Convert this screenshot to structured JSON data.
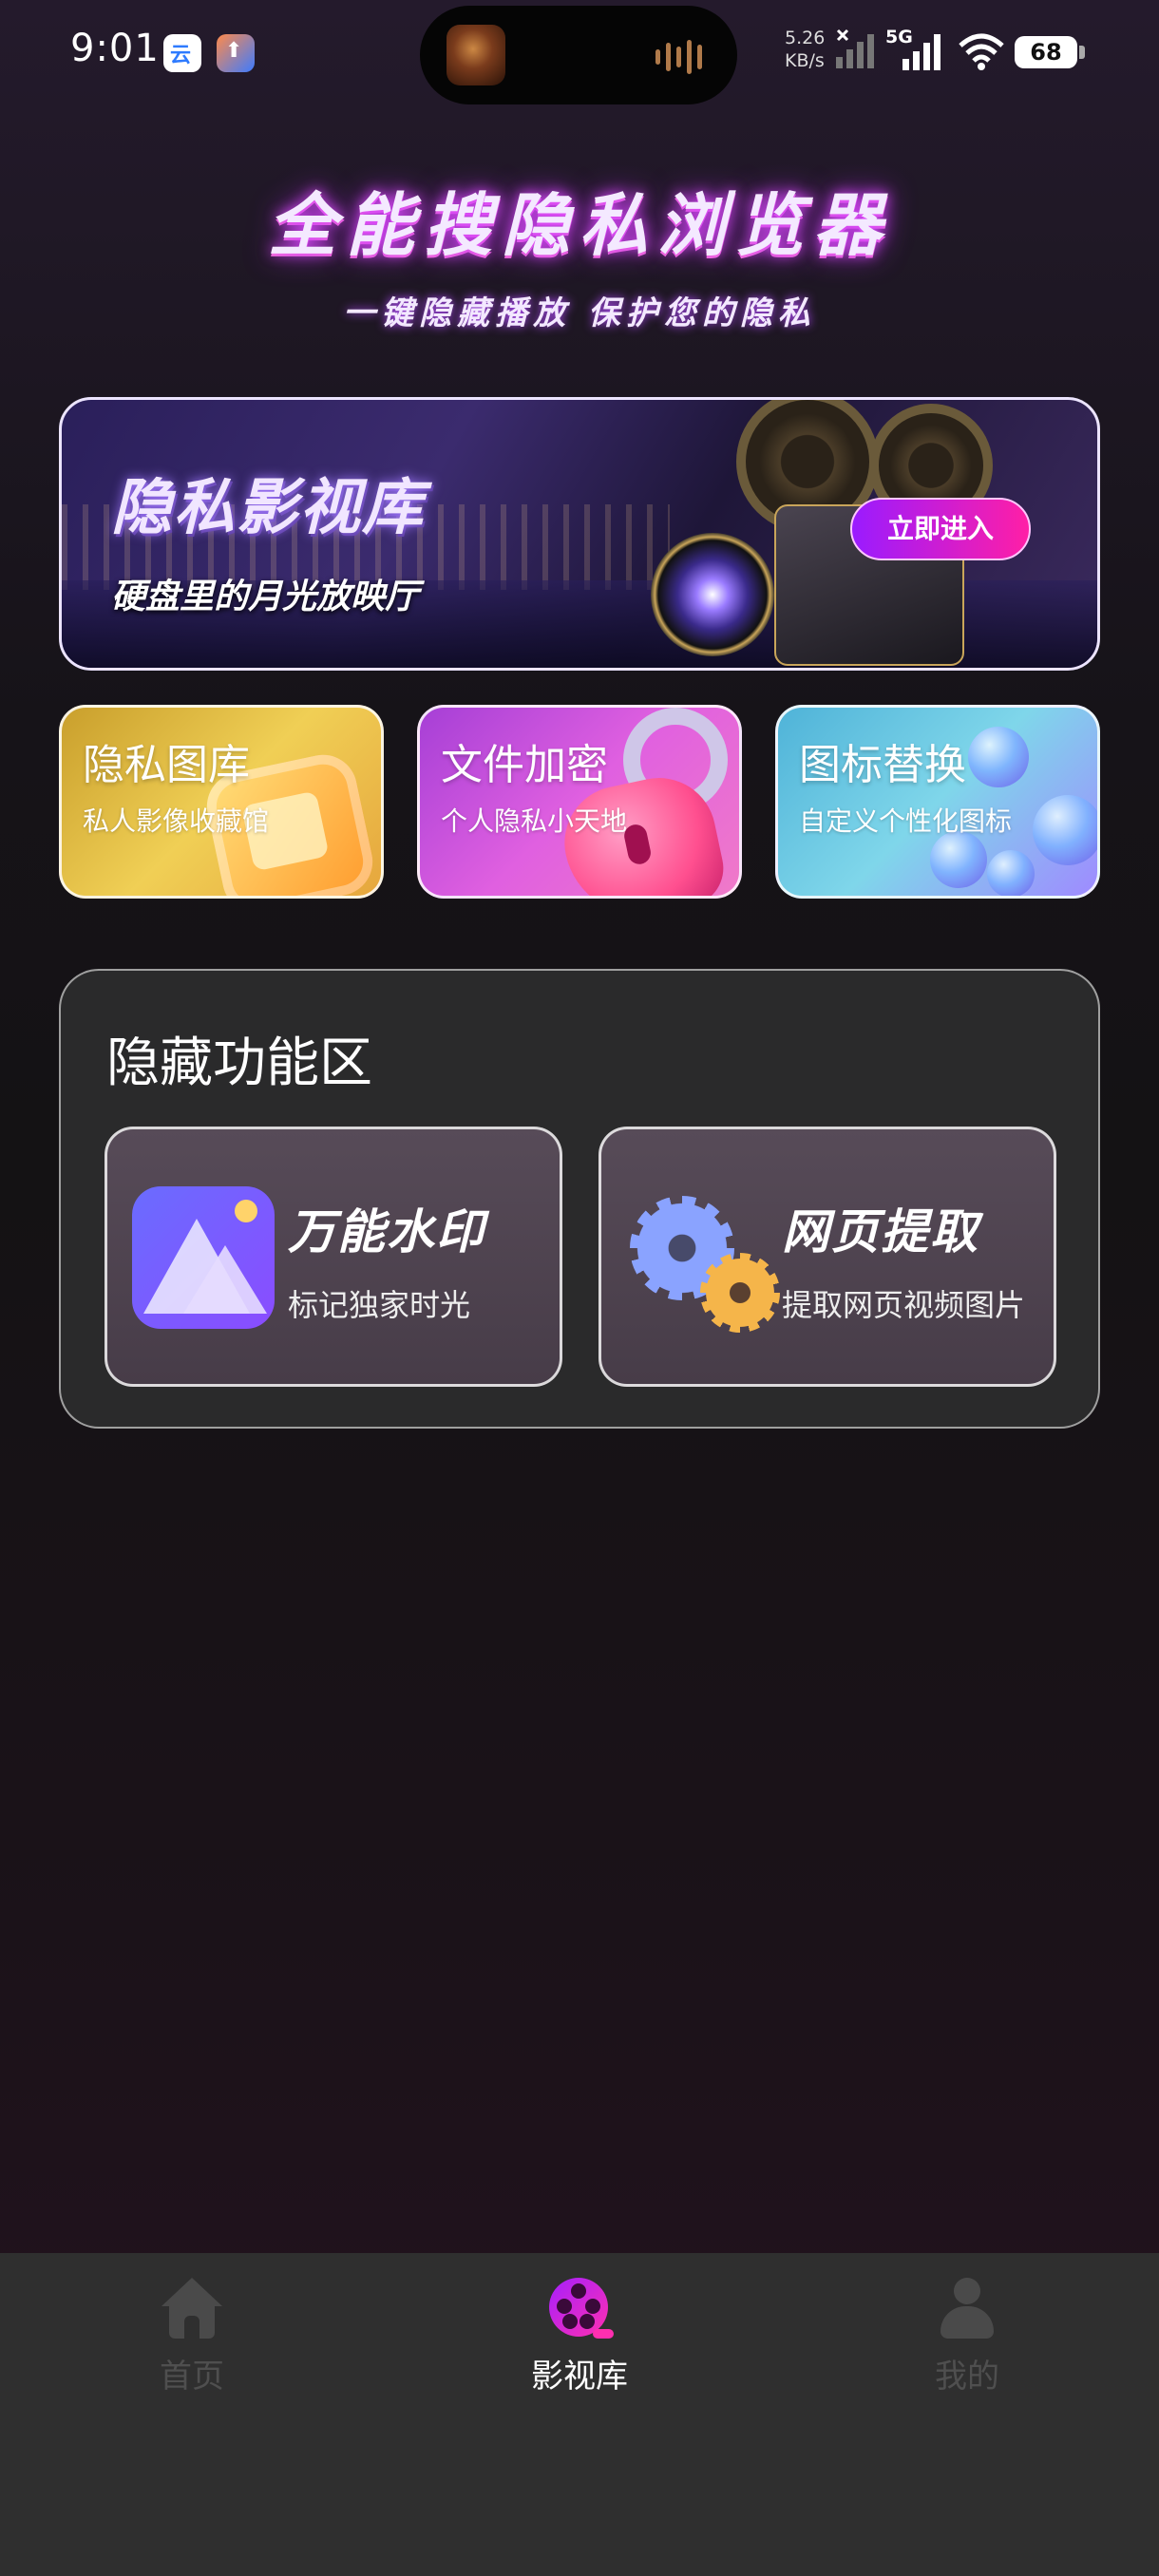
{
  "status_bar": {
    "time": "9:01",
    "net_speed_value": "5.26",
    "net_speed_unit": "KB/s",
    "network_type": "5G",
    "battery": "68"
  },
  "header": {
    "title": "全能搜隐私浏览器",
    "subtitle": "一键隐藏播放  保护您的隐私"
  },
  "banner": {
    "title": "隐私影视库",
    "subtitle": "硬盘里的月光放映厅",
    "button_label": "立即进入"
  },
  "feature_cards": [
    {
      "title": "隐私图库",
      "subtitle": "私人影像收藏馆",
      "color": "#e8b83c"
    },
    {
      "title": "文件加密",
      "subtitle": "个人隐私小天地",
      "color": "#d44fe0"
    },
    {
      "title": "图标替换",
      "subtitle": "自定义个性化图标",
      "color": "#6cc8e4"
    }
  ],
  "hidden_panel": {
    "title": "隐藏功能区",
    "tools": [
      {
        "title": "万能水印",
        "subtitle": "标记独家时光",
        "icon": "watermark-icon"
      },
      {
        "title": "网页提取",
        "subtitle": "提取网页视频图片",
        "icon": "gears-icon"
      }
    ]
  },
  "bottom_nav": {
    "items": [
      {
        "label": "首页",
        "icon": "home-icon",
        "active": false
      },
      {
        "label": "影视库",
        "icon": "film-reel-icon",
        "active": true
      },
      {
        "label": "我的",
        "icon": "user-icon",
        "active": false
      }
    ],
    "active_color": "#ffffff",
    "inactive_color": "#4f4f4f",
    "accent": "#c21fff"
  }
}
